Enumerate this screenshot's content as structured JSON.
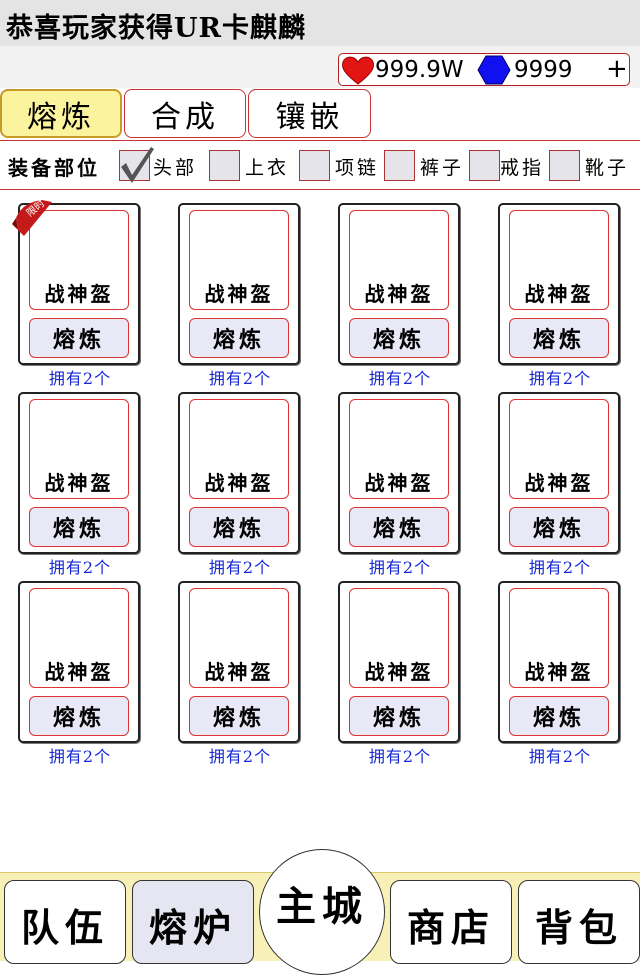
{
  "banner": {
    "text": "恭喜玩家获得UR卡麒麟"
  },
  "currency": {
    "hp": "999.9W",
    "gems": "9999",
    "add_label": "+"
  },
  "tabs": [
    {
      "label": "熔炼",
      "active": true
    },
    {
      "label": "合成",
      "active": false
    },
    {
      "label": "镶嵌",
      "active": false
    }
  ],
  "filter": {
    "label": "装备部位",
    "options": [
      {
        "label": "头部",
        "checked": true
      },
      {
        "label": "上衣",
        "checked": false
      },
      {
        "label": "项链",
        "checked": false
      },
      {
        "label": "裤子",
        "checked": false
      },
      {
        "label": "戒指",
        "checked": false
      },
      {
        "label": "靴子",
        "checked": false
      }
    ]
  },
  "cards": [
    {
      "name": "战神盔",
      "button": "熔炼",
      "owned": "拥有2个",
      "badge": "限时"
    },
    {
      "name": "战神盔",
      "button": "熔炼",
      "owned": "拥有2个"
    },
    {
      "name": "战神盔",
      "button": "熔炼",
      "owned": "拥有2个"
    },
    {
      "name": "战神盔",
      "button": "熔炼",
      "owned": "拥有2个"
    },
    {
      "name": "战神盔",
      "button": "熔炼",
      "owned": "拥有2个"
    },
    {
      "name": "战神盔",
      "button": "熔炼",
      "owned": "拥有2个"
    },
    {
      "name": "战神盔",
      "button": "熔炼",
      "owned": "拥有2个"
    },
    {
      "name": "战神盔",
      "button": "熔炼",
      "owned": "拥有2个"
    },
    {
      "name": "战神盔",
      "button": "熔炼",
      "owned": "拥有2个"
    },
    {
      "name": "战神盔",
      "button": "熔炼",
      "owned": "拥有2个"
    },
    {
      "name": "战神盔",
      "button": "熔炼",
      "owned": "拥有2个"
    },
    {
      "name": "战神盔",
      "button": "熔炼",
      "owned": "拥有2个"
    }
  ],
  "nav": [
    {
      "label": "队伍"
    },
    {
      "label": "熔炉",
      "active": true
    },
    {
      "label": "主城"
    },
    {
      "label": "商店"
    },
    {
      "label": "背包"
    }
  ],
  "colors": {
    "accent_red": "#c83232",
    "tab_active": "#fbf39e",
    "nav_bg": "#f7f1b8",
    "owned_text": "#1528d6",
    "gem_blue": "#1010f0"
  }
}
